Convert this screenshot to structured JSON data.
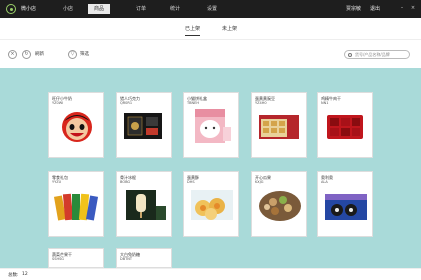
{
  "app": {
    "name": "微小店"
  },
  "nav": [
    {
      "label": "小店"
    },
    {
      "label": "商品"
    },
    {
      "label": "订单"
    },
    {
      "label": "统计"
    },
    {
      "label": "设置"
    }
  ],
  "user": {
    "name": "贾宗敏",
    "logout": "退出"
  },
  "window": {
    "minimize": "–",
    "close": "×"
  },
  "tabs": [
    {
      "label": "已上架"
    },
    {
      "label": "未上架"
    }
  ],
  "toolbar": {
    "refresh_label": "刷新",
    "filter_label": "筛选",
    "search_placeholder": "货号/产品名称/品牌"
  },
  "products": [
    {
      "name": "旺仔小牛奶",
      "code": "YZ0WI"
    },
    {
      "name": "猎人巧克力",
      "code": "QR0R1"
    },
    {
      "name": "小猫饼礼盒",
      "code": "TBNEH"
    },
    {
      "name": "蛋黄黄豌豆",
      "code": "YZ4H0"
    },
    {
      "name": "鸡精牛肉干",
      "code": "NN1"
    },
    {
      "name": "零食礼包",
      "code": "YYZU"
    },
    {
      "name": "骨汁冰棍",
      "code": "BOBG"
    },
    {
      "name": "蛋黄酥",
      "code": "DHS"
    },
    {
      "name": "开心瓜果",
      "code": "KXJG"
    },
    {
      "name": "奥利奥",
      "code": "ALA"
    },
    {
      "name": "蔬菜芒果干",
      "code": "SSHSG"
    },
    {
      "name": "大白兔奶糖",
      "code": "DBTNT"
    }
  ],
  "footer": {
    "count_label": "总数:",
    "count_value": "12"
  }
}
